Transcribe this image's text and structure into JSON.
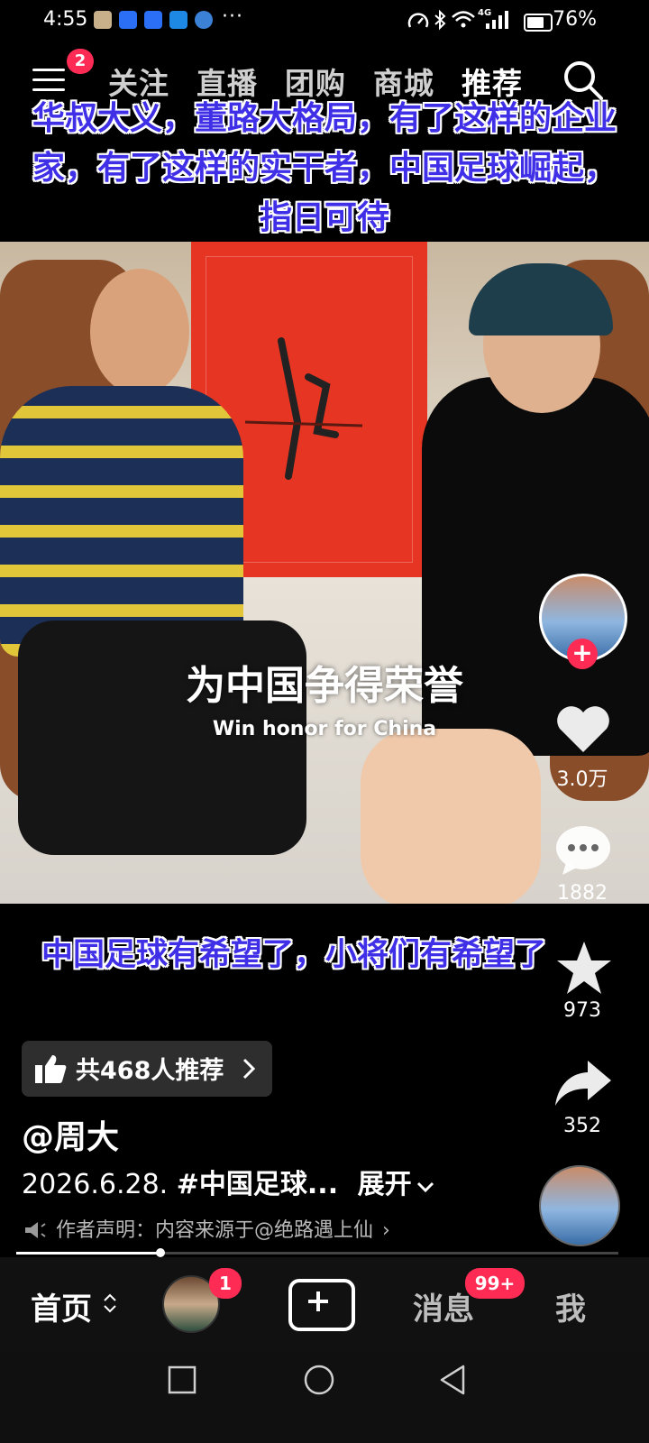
{
  "status_bar": {
    "time": "4:55",
    "more": "···",
    "network": "4G",
    "battery_percent": "76%",
    "battery_level": 0.76
  },
  "top_nav": {
    "menu_badge": "2",
    "tabs": [
      "关注",
      "直播",
      "团购",
      "商城",
      "推荐"
    ],
    "active_tab": "推荐"
  },
  "video": {
    "caption_top": "华叔大义，董路大格局，有了这样的企业家，有了这样的实干者，中国足球崛起，指日可待",
    "subtitle_cn": "为中国争得荣誉",
    "subtitle_en": "Win honor for China",
    "caption_bottom": "中国足球有希望了，小将们有希望了",
    "progress": 0.24
  },
  "actions": {
    "follow_plus": "+",
    "likes": "3.0万",
    "comments": "1882",
    "favorites": "973",
    "shares": "352"
  },
  "info": {
    "recommend": "共468人推荐",
    "author": "@周大",
    "desc_prefix": "2026.6.28. ",
    "desc_tag": "#中国足球...",
    "expand": "展开",
    "declaration": "作者声明：内容来源于@绝路遇上仙"
  },
  "bottom_tabs": {
    "home": "首页",
    "friends_badge": "1",
    "messages": "消息",
    "messages_badge": "99+",
    "me": "我"
  },
  "colors": {
    "accent": "#fe2c55",
    "caption_text": "#3f2fe6"
  }
}
